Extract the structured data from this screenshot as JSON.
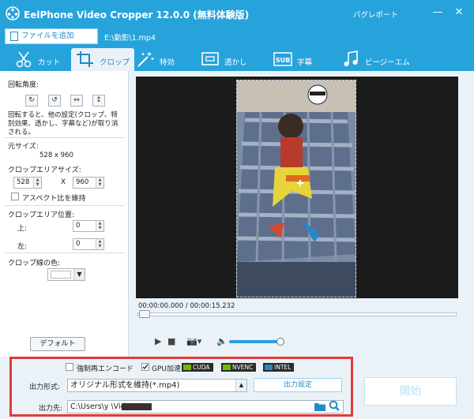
{
  "window": {
    "title": "EelPhone Video Cropper 12.0.0 (無料体験版)",
    "bug_report": "バグレポート",
    "minimize": "—",
    "close": "✕"
  },
  "filebar": {
    "add_file": "ファイルを追加",
    "file_name": "E:\\動影\\1.mp4"
  },
  "tabs": [
    {
      "label": "カット",
      "icon": "scissors-icon"
    },
    {
      "label": "クロップ",
      "icon": "crop-icon"
    },
    {
      "label": "特効",
      "icon": "magic-wand-icon"
    },
    {
      "label": "透かし",
      "icon": "watermark-icon"
    },
    {
      "label": "字幕",
      "icon": "subtitle-icon"
    },
    {
      "label": "ビージーエム",
      "icon": "music-note-icon"
    }
  ],
  "left": {
    "rotation_label": "回転角度:",
    "rotate_buttons": [
      "↻",
      "↺",
      "↔",
      "↕"
    ],
    "rotation_note": "回転すると、他の設定(クロップ、特別効果、透かし、字幕など)が取り消される。",
    "original_size_label": "元サイズ:",
    "original_size_value": "528 x 960",
    "crop_area_size_label": "クロップエリアサイズ:",
    "crop_width": "528",
    "crop_x": "X",
    "crop_height": "960",
    "keep_aspect": "アスペクト比を維持",
    "crop_area_position_label": "クロップエリア位置:",
    "top_label": "上:",
    "top_value": "0",
    "left_label": "左:",
    "left_value": "0",
    "crop_line_color_label": "クロップ線の色:",
    "default_button": "デフォルト"
  },
  "player": {
    "time": "00:00:00.000 / 00:00:15.232",
    "play": "▶",
    "stop": "■",
    "camera": "📷▾",
    "volume": "🔈"
  },
  "bottom": {
    "force_encode": "強制再エンコード",
    "gpu_accel": "GPU加速",
    "chips": [
      "CUDA",
      "NVENC",
      "INTEL"
    ],
    "output_format_label": "出力形式:",
    "output_format_value": "オリジナル形式を維持(*.mp4)",
    "output_settings": "出力設定",
    "output_dest_label": "出力先:",
    "output_path": "C:\\Users\\y          \\Videos\\",
    "start": "開始"
  },
  "colors": {
    "brand_blue": "#27a3dc",
    "highlight_border": "#e23b3b"
  }
}
